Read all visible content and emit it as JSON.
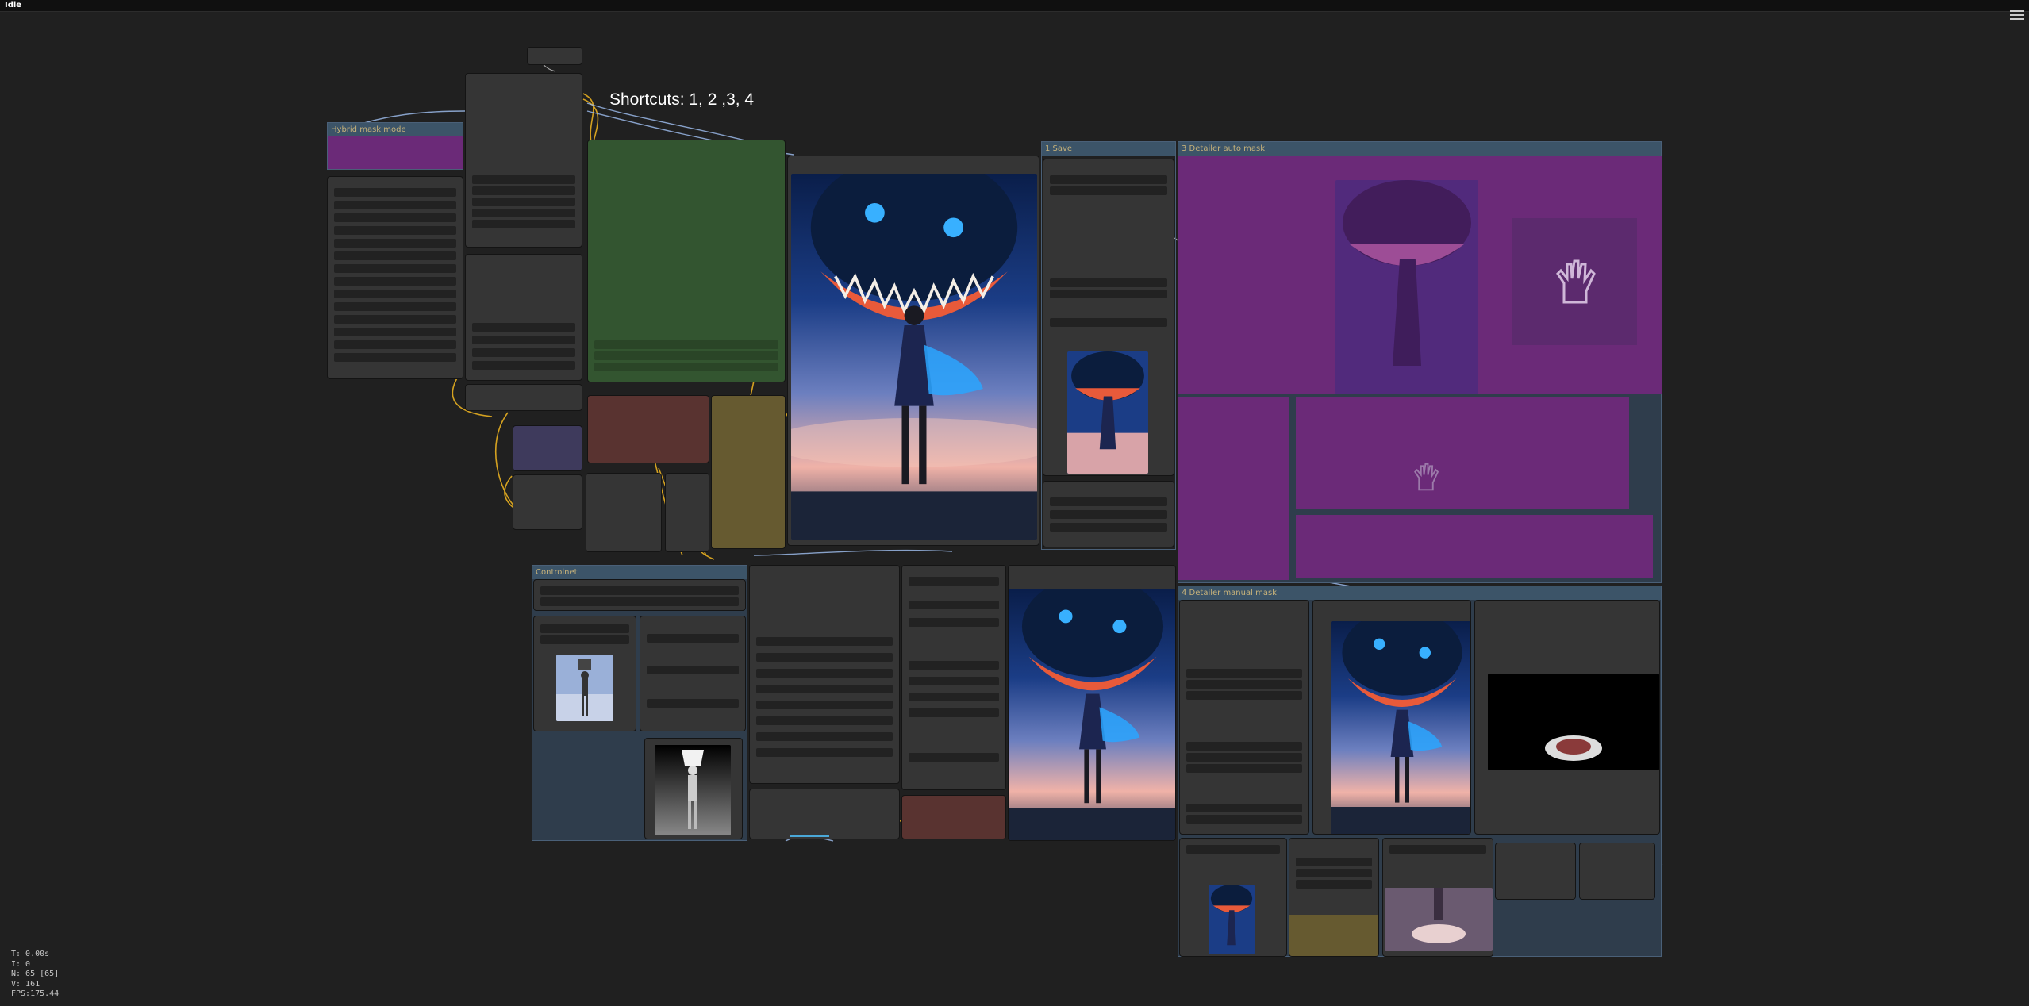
{
  "app": {
    "status": "Idle"
  },
  "note": {
    "text": "Shortcuts: 1, 2 ,3, 4"
  },
  "groups": {
    "hybrid": "Hybrid mask mode",
    "save": "1 Save",
    "detailer_auto": "3 Detailer auto mask",
    "controlnet": "Controlnet",
    "detailer_manual": "4 Detailer manual mask"
  },
  "stats": {
    "t": "T: 0.00s",
    "i": "I: 0",
    "n": "N: 65 [65]",
    "v": "V: 161",
    "fps": "FPS:175.44"
  },
  "icons": {
    "menu": "hamburger-menu-icon",
    "mask": "hand-mask-icon"
  },
  "colors": {
    "canvas": "#202020",
    "node": "#353535",
    "group_purple": "#6b2a78",
    "group_green": "#335530",
    "group_brown": "#593330",
    "group_gold": "#665a30",
    "group_indigo": "#3e3a5c",
    "group_slate": "#2f3d4c",
    "wire_yellow": "#e8b020",
    "wire_blue": "#9ab8e8"
  }
}
